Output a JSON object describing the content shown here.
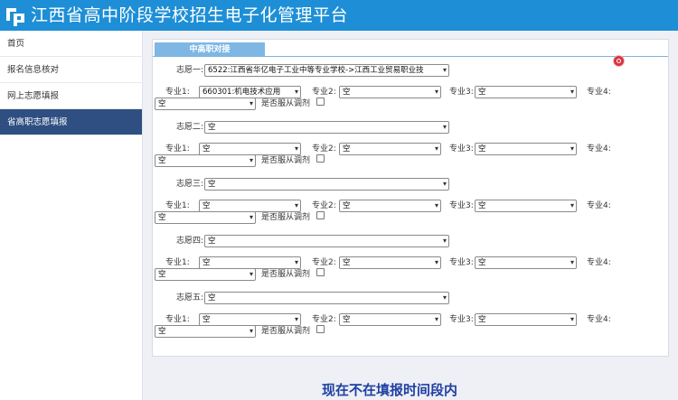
{
  "header": {
    "title": "江西省高中阶段学校招生电子化管理平台"
  },
  "sidebar": {
    "items": [
      {
        "label": "首页",
        "active": false
      },
      {
        "label": "报名信息核对",
        "active": false
      },
      {
        "label": "网上志愿填报",
        "active": false
      },
      {
        "label": "省高职志愿填报",
        "active": true
      }
    ]
  },
  "panel": {
    "tab_label": "中高职对接"
  },
  "choices": [
    {
      "label": "志愿一:",
      "school": "6522:江西省华亿电子工业中等专业学校->江西工业贸易职业技",
      "majors": [
        {
          "label": "专业1:",
          "value": "660301:机电技术应用"
        },
        {
          "label": "专业2:",
          "value": "空"
        },
        {
          "label": "专业3:",
          "value": "空"
        },
        {
          "label": "专业4:",
          "value": "空"
        }
      ],
      "adjust_label": "是否服从调剂"
    },
    {
      "label": "志愿二:",
      "school": "空",
      "majors": [
        {
          "label": "专业1:",
          "value": "空"
        },
        {
          "label": "专业2:",
          "value": "空"
        },
        {
          "label": "专业3:",
          "value": "空"
        },
        {
          "label": "专业4:",
          "value": "空"
        }
      ],
      "adjust_label": "是否服从调剂"
    },
    {
      "label": "志愿三:",
      "school": "空",
      "majors": [
        {
          "label": "专业1:",
          "value": "空"
        },
        {
          "label": "专业2:",
          "value": "空"
        },
        {
          "label": "专业3:",
          "value": "空"
        },
        {
          "label": "专业4:",
          "value": "空"
        }
      ],
      "adjust_label": "是否服从调剂"
    },
    {
      "label": "志愿四:",
      "school": "空",
      "majors": [
        {
          "label": "专业1:",
          "value": "空"
        },
        {
          "label": "专业2:",
          "value": "空"
        },
        {
          "label": "专业3:",
          "value": "空"
        },
        {
          "label": "专业4:",
          "value": "空"
        }
      ],
      "adjust_label": "是否服从调剂"
    },
    {
      "label": "志愿五:",
      "school": "空",
      "majors": [
        {
          "label": "专业1:",
          "value": "空"
        },
        {
          "label": "专业2:",
          "value": "空"
        },
        {
          "label": "专业3:",
          "value": "空"
        },
        {
          "label": "专业4:",
          "value": "空"
        }
      ],
      "adjust_label": "是否服从调剂"
    }
  ],
  "notice": "现在不在填报时间段内",
  "icons": {
    "logo": "platform-logo-icon",
    "close": "close-dot-icon",
    "select": "chevron-down-icon"
  },
  "colors": {
    "header": "#1e8fd6",
    "nav_active": "#2f4f82",
    "tab": "#7eb7e4",
    "notice": "#1f3fa3",
    "close": "#d9333f"
  }
}
